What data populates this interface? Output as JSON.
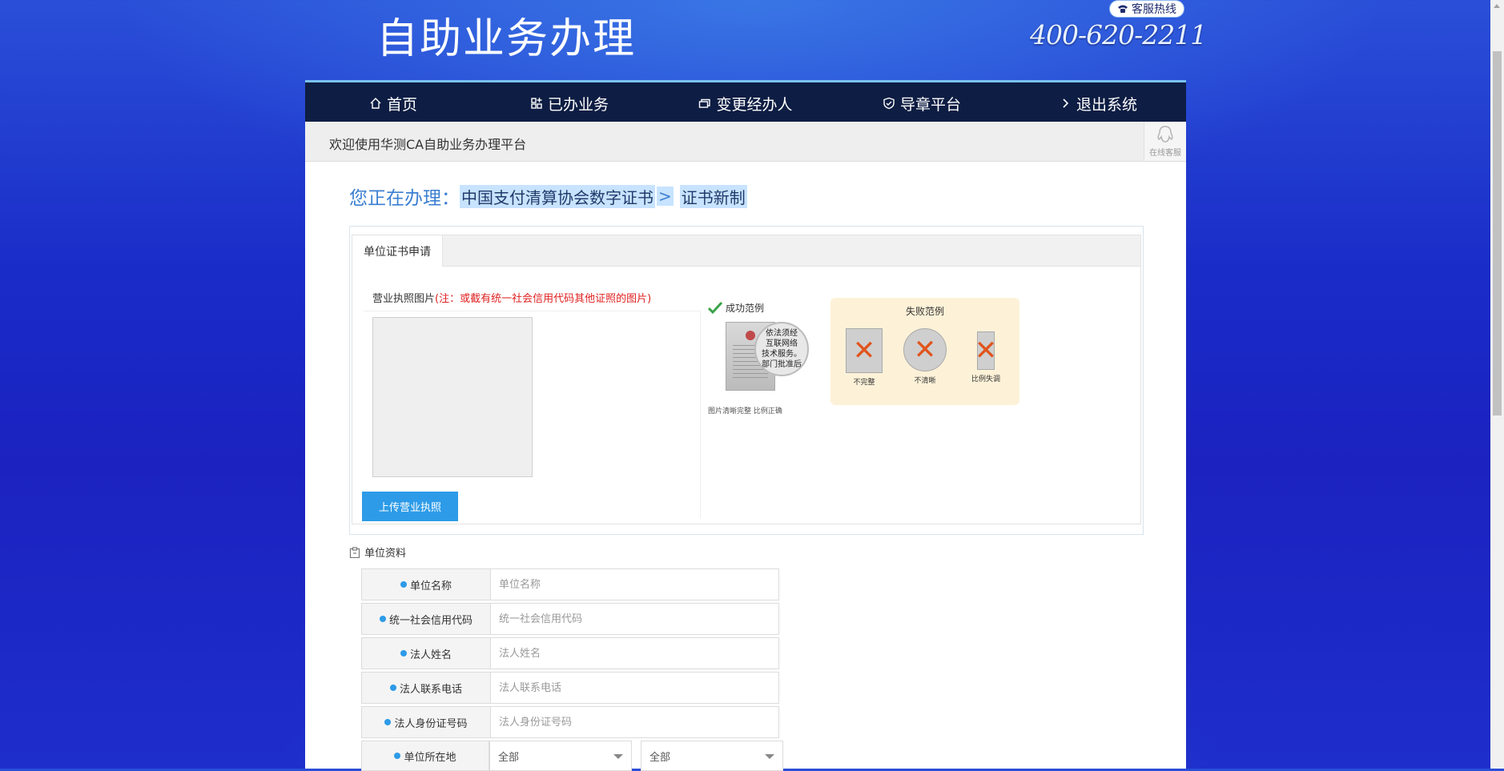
{
  "header": {
    "title": "自助业务办理",
    "hotline_label": "客服热线",
    "hotline_number": "400-620-2211"
  },
  "nav": {
    "items": [
      {
        "label": "首页",
        "icon": "home-icon"
      },
      {
        "label": "已办业务",
        "icon": "apps-icon"
      },
      {
        "label": "变更经办人",
        "icon": "change-person-icon"
      },
      {
        "label": "导章平台",
        "icon": "shield-check-icon"
      },
      {
        "label": "退出系统",
        "icon": "chevron-right-icon"
      }
    ]
  },
  "welcome": {
    "text": "欢迎使用华测CA自助业务办理平台",
    "service_label": "在线客服"
  },
  "processing": {
    "prefix": "您正在办理：",
    "item": "中国支付清算协会数字证书",
    "separator": ">",
    "action": "证书新制"
  },
  "tabs": {
    "active": "单位证书申请"
  },
  "upload": {
    "label": "营业执照图片",
    "note": "(注：或截有统一社会信用代码其他证照的图片)",
    "button": "上传营业执照"
  },
  "examples": {
    "success_label": "成功范例",
    "success_zoom_text": [
      "依法须经",
      "互联网络",
      "技术服务。",
      "部门批准后"
    ],
    "success_caption": "图片清晰完整  比例正确",
    "fail_label": "失败范例",
    "fail_items": [
      "不完整",
      "不清晰",
      "比例失调"
    ]
  },
  "form": {
    "section_title": "单位资料",
    "fields": [
      {
        "label": "单位名称",
        "placeholder": "单位名称"
      },
      {
        "label": "统一社会信用代码",
        "placeholder": "统一社会信用代码"
      },
      {
        "label": "法人姓名",
        "placeholder": "法人姓名"
      },
      {
        "label": "法人联系电话",
        "placeholder": "法人联系电话"
      },
      {
        "label": "法人身份证号码",
        "placeholder": "法人身份证号码"
      }
    ],
    "location": {
      "label": "单位所在地",
      "province": "全部",
      "city": "全部"
    }
  },
  "colors": {
    "nav_bg": "#0e1d43",
    "accent": "#2d9be8",
    "note_red": "#e02020",
    "title_blue": "#3b7fd1"
  }
}
